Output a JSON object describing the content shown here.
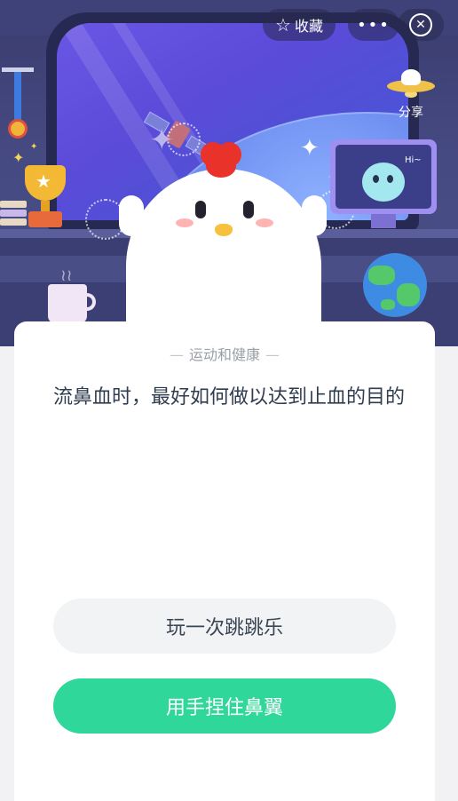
{
  "header": {
    "favorite_label": "收藏",
    "more_label": "•••",
    "share_label": "分享"
  },
  "scene": {
    "monitor_greeting": "Hi~"
  },
  "quiz": {
    "category": "运动和健康",
    "question": "流鼻血时，最好如何做以达到止血的目的",
    "options": [
      {
        "label": "玩一次跳跳乐",
        "selected": false
      },
      {
        "label": "用手捏住鼻翼",
        "selected": true
      }
    ]
  },
  "colors": {
    "accent_green": "#2fd79b",
    "option_gray": "#f2f3f5",
    "question_text": "#2f3d4f",
    "category_text": "#9aa0a8"
  },
  "icons": [
    "star-icon",
    "more-icon",
    "close-icon",
    "ufo-share-icon"
  ]
}
